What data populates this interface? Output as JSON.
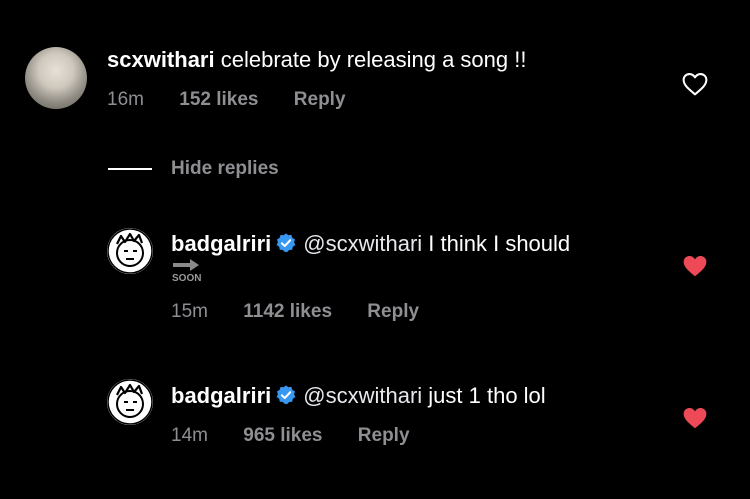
{
  "colors": {
    "background": "#000000",
    "text": "#ffffff",
    "secondary": "#8e8e93",
    "heart_filled": "#ed4956",
    "verified": "#3897f0"
  },
  "parent_comment": {
    "username": "scxwithari",
    "text": "celebrate by releasing a song !!",
    "time": "16m",
    "likes": "152 likes",
    "reply": "Reply",
    "liked": false
  },
  "hide_replies": "Hide replies",
  "replies": [
    {
      "username": "badgalriri",
      "verified": true,
      "mention": "@scxwithari",
      "text": "I think I should",
      "emoji": "soon-arrow-emoji",
      "emoji_label": "SOON",
      "time": "15m",
      "likes": "1142 likes",
      "reply": "Reply",
      "liked": true
    },
    {
      "username": "badgalriri",
      "verified": true,
      "mention": "@scxwithari",
      "text": "just 1 tho lol",
      "time": "14m",
      "likes": "965 likes",
      "reply": "Reply",
      "liked": true
    }
  ]
}
